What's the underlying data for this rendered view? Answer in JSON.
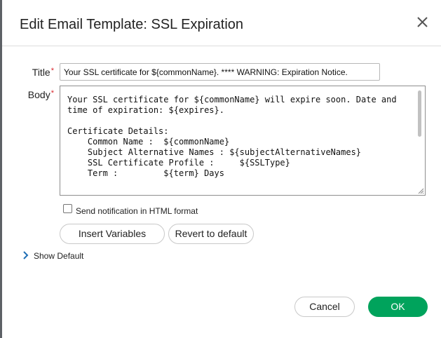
{
  "dialog": {
    "title": "Edit Email Template: SSL Expiration",
    "close_icon": "close-icon"
  },
  "form": {
    "title_label": "Title",
    "body_label": "Body",
    "required_marker": "*",
    "title_value": "Your SSL certificate for ${commonName}. **** WARNING: Expiration Notice.",
    "body_value": "Your SSL certificate for ${commonName} will expire soon. Date and\ntime of expiration: ${expires}.\n\nCertificate Details:\n    Common Name :  ${commonName}\n    Subject Alternative Names : ${subjectAlternativeNames}\n    SSL Certificate Profile :     ${SSLType}\n    Term :         ${term} Days",
    "html_format_label": "Send notification in HTML format",
    "html_format_checked": false
  },
  "actions": {
    "insert_variables": "Insert Variables",
    "revert_to_default": "Revert to default",
    "show_default": "Show Default",
    "cancel": "Cancel",
    "ok": "OK"
  },
  "colors": {
    "required": "#d9262c",
    "primary": "#00a35c"
  }
}
